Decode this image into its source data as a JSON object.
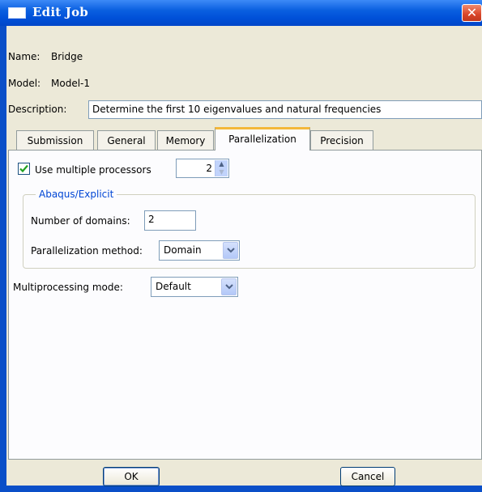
{
  "window": {
    "title": "Edit Job",
    "title_icon": "window-icon",
    "close_icon": "close-icon",
    "close_glyph": "✕"
  },
  "fields": {
    "name_label": "Name:",
    "name_value": "Bridge",
    "model_label": "Model:",
    "model_value": "Model-1",
    "description_label": "Description:",
    "description_value": "Determine the first 10 eigenvalues and natural frequencies"
  },
  "tabs": [
    {
      "label": "Submission"
    },
    {
      "label": "General"
    },
    {
      "label": "Memory"
    },
    {
      "label": "Parallelization",
      "active": true
    },
    {
      "label": "Precision"
    }
  ],
  "parallelization": {
    "use_multiple_processors_label": "Use multiple processors",
    "use_multiple_processors_checked": true,
    "processors_value": "2",
    "explicit_group_title": "Abaqus/Explicit",
    "domains_label": "Number of domains:",
    "domains_value": "2",
    "method_label": "Parallelization method:",
    "method_value": "Domain",
    "mode_label": "Multiprocessing mode:",
    "mode_value": "Default"
  },
  "buttons": {
    "ok": "OK",
    "cancel": "Cancel"
  },
  "colors": {
    "title_bar": "#0050d8",
    "tab_highlight": "#f3b73b",
    "group_title": "#0046d5",
    "close_button": "#d9462a"
  }
}
